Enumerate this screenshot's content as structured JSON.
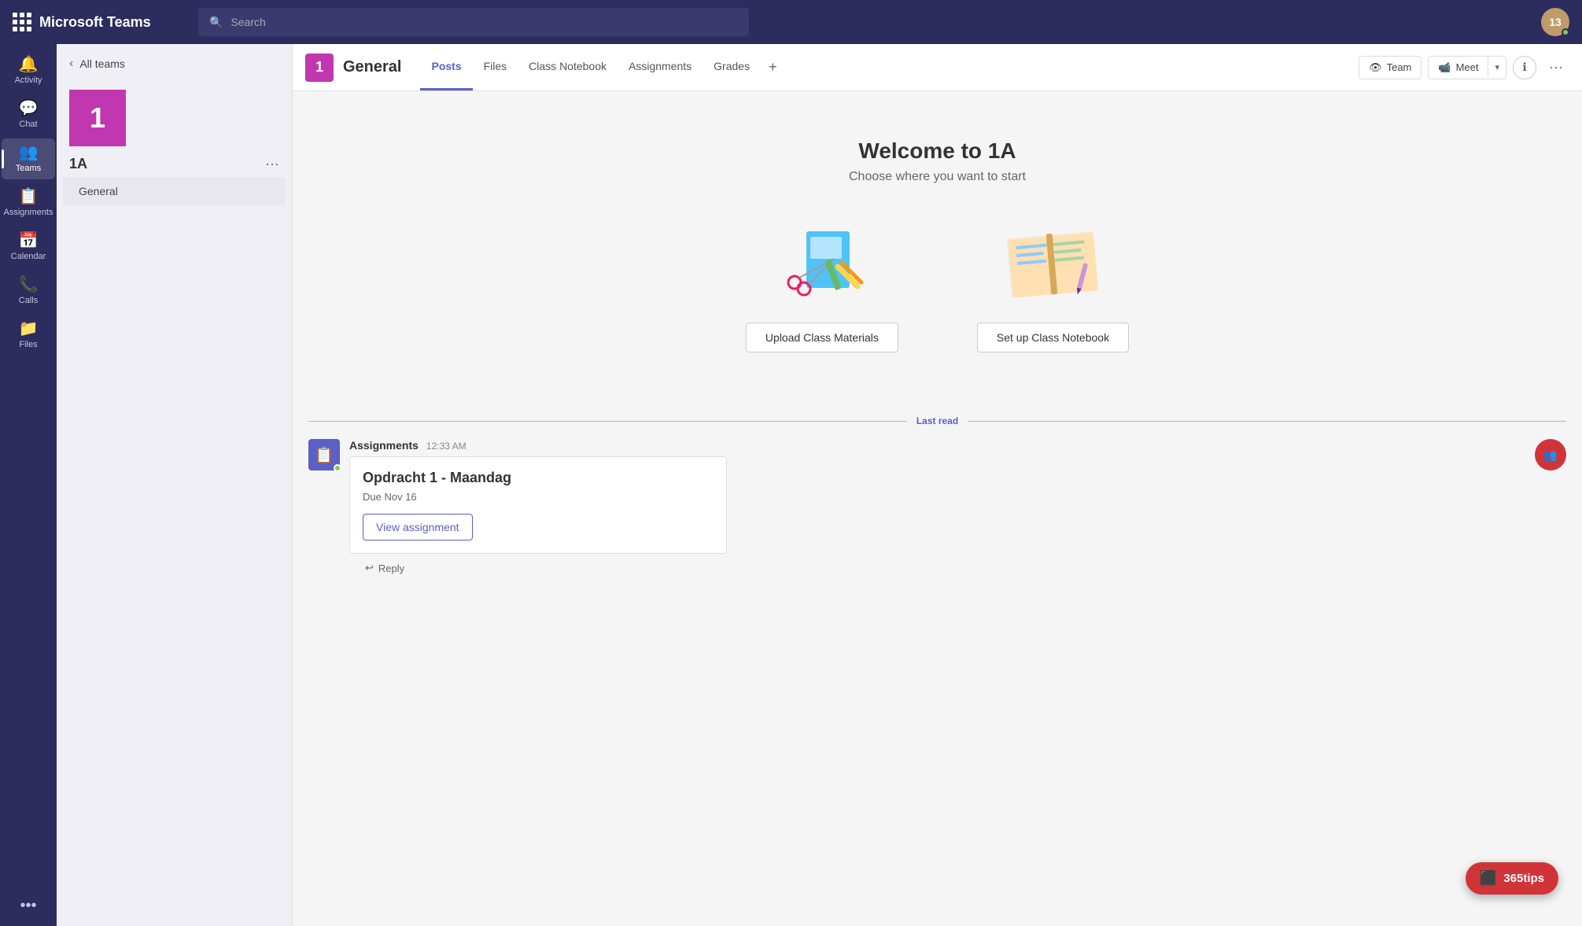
{
  "app": {
    "title": "Microsoft Teams",
    "search_placeholder": "Search"
  },
  "topbar": {
    "logo": "Microsoft Teams",
    "avatar_initials": "13",
    "search_placeholder": "Search"
  },
  "sidebar": {
    "items": [
      {
        "id": "activity",
        "label": "Activity",
        "icon": "🔔"
      },
      {
        "id": "chat",
        "label": "Chat",
        "icon": "💬"
      },
      {
        "id": "teams",
        "label": "Teams",
        "icon": "👥",
        "active": true
      },
      {
        "id": "assignments",
        "label": "Assignments",
        "icon": "📋"
      },
      {
        "id": "calendar",
        "label": "Calendar",
        "icon": "📅"
      },
      {
        "id": "calls",
        "label": "Calls",
        "icon": "📞"
      },
      {
        "id": "files",
        "label": "Files",
        "icon": "📁"
      }
    ],
    "more_label": "•••"
  },
  "teams_panel": {
    "back_label": "All teams",
    "team_number": "1",
    "team_name": "1A",
    "channel": "General"
  },
  "tab_bar": {
    "team_number": "1",
    "channel_title": "General",
    "tabs": [
      {
        "id": "posts",
        "label": "Posts",
        "active": true
      },
      {
        "id": "files",
        "label": "Files"
      },
      {
        "id": "class-notebook",
        "label": "Class Notebook"
      },
      {
        "id": "assignments",
        "label": "Assignments"
      },
      {
        "id": "grades",
        "label": "Grades"
      }
    ],
    "team_btn": "Team",
    "meet_btn": "Meet",
    "more_label": "···"
  },
  "welcome": {
    "title": "Welcome to 1A",
    "subtitle": "Choose where you want to start",
    "upload_btn": "Upload Class Materials",
    "notebook_btn": "Set up Class Notebook"
  },
  "last_read": {
    "label": "Last read"
  },
  "message": {
    "sender": "Assignments",
    "time": "12:33 AM",
    "assignment_title": "Opdracht 1 - Maandag",
    "due": "Due Nov 16",
    "view_btn": "View assignment",
    "reply_label": "Reply"
  },
  "tips": {
    "label": "365tips",
    "icon": "🔴"
  }
}
